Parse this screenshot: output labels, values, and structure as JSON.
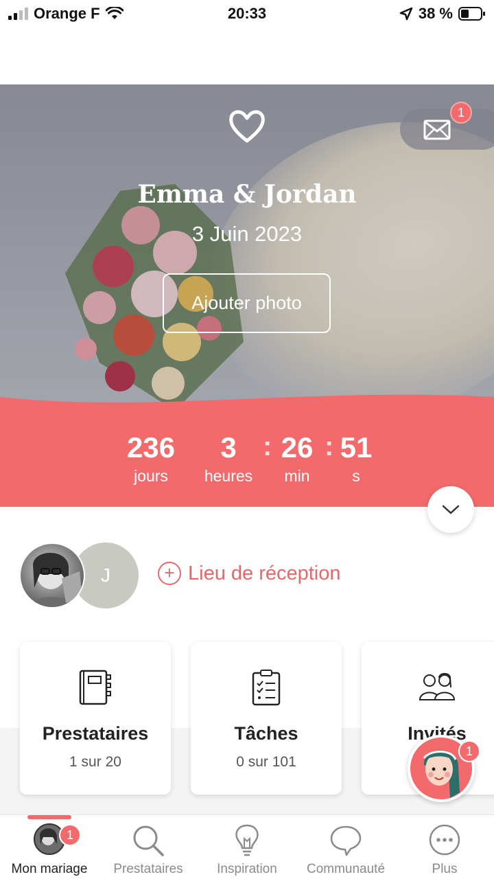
{
  "status_bar": {
    "carrier": "Orange F",
    "time": "20:33",
    "battery": "38 %"
  },
  "hero": {
    "names": "Emma & Jordan",
    "date": "3 Juin 2023",
    "add_photo_label": "Ajouter photo",
    "mail_badge": "1"
  },
  "countdown": {
    "days": "236",
    "days_label": "jours",
    "hours": "3",
    "hours_label": "heures",
    "minutes": "26",
    "minutes_label": "min",
    "seconds": "51",
    "seconds_label": "s"
  },
  "couple": {
    "partner_initial": "J",
    "venue_label": "Lieu de réception"
  },
  "cards": [
    {
      "title": "Prestataires",
      "subtitle": "1 sur 20"
    },
    {
      "title": "Tâches",
      "subtitle": "0 sur 101"
    },
    {
      "title": "Invités",
      "subtitle": ""
    }
  ],
  "assistant": {
    "badge": "1"
  },
  "tabbar": {
    "items": [
      {
        "label": "Mon mariage",
        "icon": "avatar"
      },
      {
        "label": "Prestataires",
        "icon": "search-icon"
      },
      {
        "label": "Inspiration",
        "icon": "lightbulb-icon"
      },
      {
        "label": "Communauté",
        "icon": "chat-bubble-icon"
      },
      {
        "label": "Plus",
        "icon": "more-icon"
      }
    ],
    "badge": "1"
  },
  "colors": {
    "accent": "#f36a6c",
    "venue_text": "#e8676b"
  }
}
